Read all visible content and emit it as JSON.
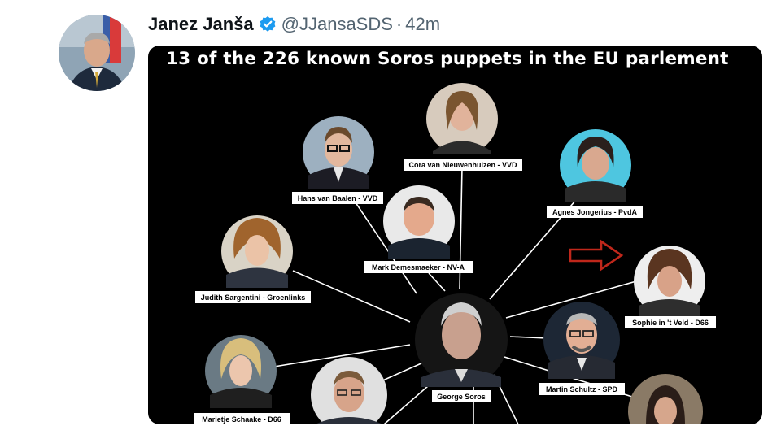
{
  "tweet": {
    "author_name": "Janez Janša",
    "handle": "@JJansaSDS",
    "separator": "·",
    "time": "42m",
    "verified_icon": "verified-badge-icon",
    "accent_color": "#1d9bf0"
  },
  "image": {
    "title": "13 of the 226 known Soros puppets in the EU parlement",
    "center": {
      "label": "George Soros"
    },
    "people": [
      {
        "label": "Cora van Nieuwenhuizen - VVD"
      },
      {
        "label": "Hans van Baalen - VVD"
      },
      {
        "label": "Agnes Jongerius - PvdA"
      },
      {
        "label": "Mark Demesmaeker - NV-A"
      },
      {
        "label": "Judith Sargentini - Groenlinks"
      },
      {
        "label": "Sophie in 't Veld - D66"
      },
      {
        "label": "Martin Schultz - SPD"
      },
      {
        "label": "Marietje Schaake - D66"
      }
    ],
    "arrow_color": "#c0271b"
  }
}
